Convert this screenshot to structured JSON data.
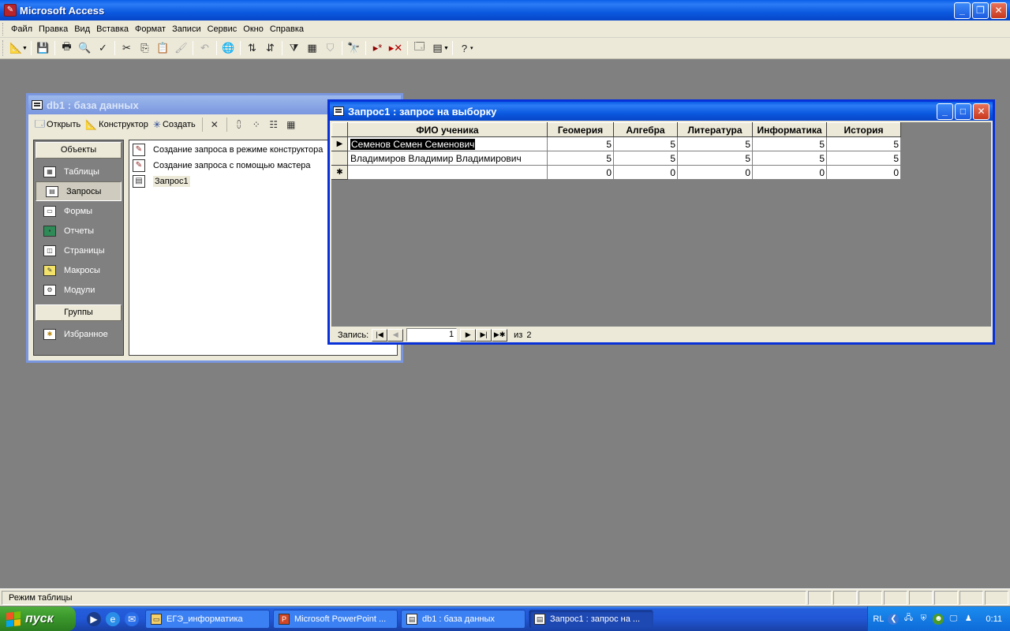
{
  "app": {
    "title": "Microsoft Access"
  },
  "menu": [
    "Файл",
    "Правка",
    "Вид",
    "Вставка",
    "Формат",
    "Записи",
    "Сервис",
    "Окно",
    "Справка"
  ],
  "db_window": {
    "title": "db1 : база данных",
    "toolbar": {
      "open": "Открыть",
      "design": "Конструктор",
      "create": "Создать"
    },
    "objects_header": "Объекты",
    "objects": [
      {
        "label": "Таблицы",
        "icon": "table-icon"
      },
      {
        "label": "Запросы",
        "icon": "query-icon"
      },
      {
        "label": "Формы",
        "icon": "form-icon"
      },
      {
        "label": "Отчеты",
        "icon": "report-icon"
      },
      {
        "label": "Страницы",
        "icon": "page-icon"
      },
      {
        "label": "Макросы",
        "icon": "macro-icon"
      },
      {
        "label": "Модули",
        "icon": "module-icon"
      }
    ],
    "groups_header": "Группы",
    "groups": [
      {
        "label": "Избранное",
        "icon": "favorites-icon"
      }
    ],
    "items": [
      "Создание запроса в режиме конструктора",
      "Создание запроса с помощью мастера",
      "Запрос1"
    ]
  },
  "query_window": {
    "title": "Запрос1 : запрос на выборку",
    "columns": [
      "ФИО ученика",
      "Геомерия",
      "Алгебра",
      "Литература",
      "Информатика",
      "История"
    ],
    "rows": [
      [
        "Семенов Семен Семенович",
        "5",
        "5",
        "5",
        "5",
        "5"
      ],
      [
        "Владимиров Владимир Владимирович",
        "5",
        "5",
        "5",
        "5",
        "5"
      ]
    ],
    "new_row": [
      "",
      "0",
      "0",
      "0",
      "0",
      "0"
    ],
    "nav": {
      "label": "Запись:",
      "current": "1",
      "of_label": "из",
      "total": "2"
    }
  },
  "status": {
    "text": "Режим таблицы"
  },
  "taskbar": {
    "start": "пуск",
    "tasks": [
      "ЕГЭ_информатика",
      "Microsoft PowerPoint ...",
      "db1 : база данных",
      "Запрос1 : запрос на ..."
    ],
    "lang": "RL",
    "clock": "0:11"
  },
  "colors": {
    "title_blue": "#0a5ee8",
    "desktop_gray": "#808080",
    "face": "#ece9d8",
    "start_green": "#3c9a2d"
  }
}
